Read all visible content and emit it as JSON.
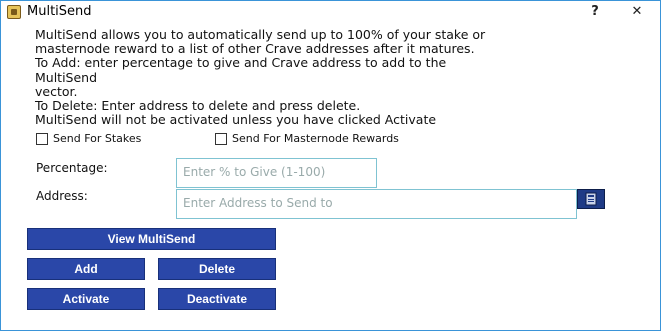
{
  "window": {
    "title": "MultiSend",
    "help_label": "?",
    "close_label": "✕"
  },
  "description": "MultiSend allows you to automatically send up to 100% of your stake or\nmasternode reward to a list of other Crave addresses after it matures.\nTo Add: enter percentage to give and Crave address to add to the MultiSend\nvector.\nTo Delete: Enter address to delete and press delete.\nMultiSend will not be activated unless you have clicked Activate",
  "options": {
    "send_for_stakes": {
      "label": "Send For Stakes",
      "checked": false
    },
    "send_for_masternode": {
      "label": "Send For Masternode Rewards",
      "checked": false
    }
  },
  "form": {
    "percentage_label": "Percentage:",
    "percentage_placeholder": "Enter % to Give (1-100)",
    "address_label": "Address:",
    "address_placeholder": "Enter Address to Send to"
  },
  "buttons": {
    "view": "View MultiSend",
    "add": "Add",
    "delete": "Delete",
    "activate": "Activate",
    "deactivate": "Deactivate"
  },
  "icons": {
    "app": "crave-app-icon",
    "address_book": "address-book-icon"
  },
  "colors": {
    "button_bg": "#2a47a8",
    "field_border": "#7fc3d2",
    "window_border": "#3a94d8"
  }
}
